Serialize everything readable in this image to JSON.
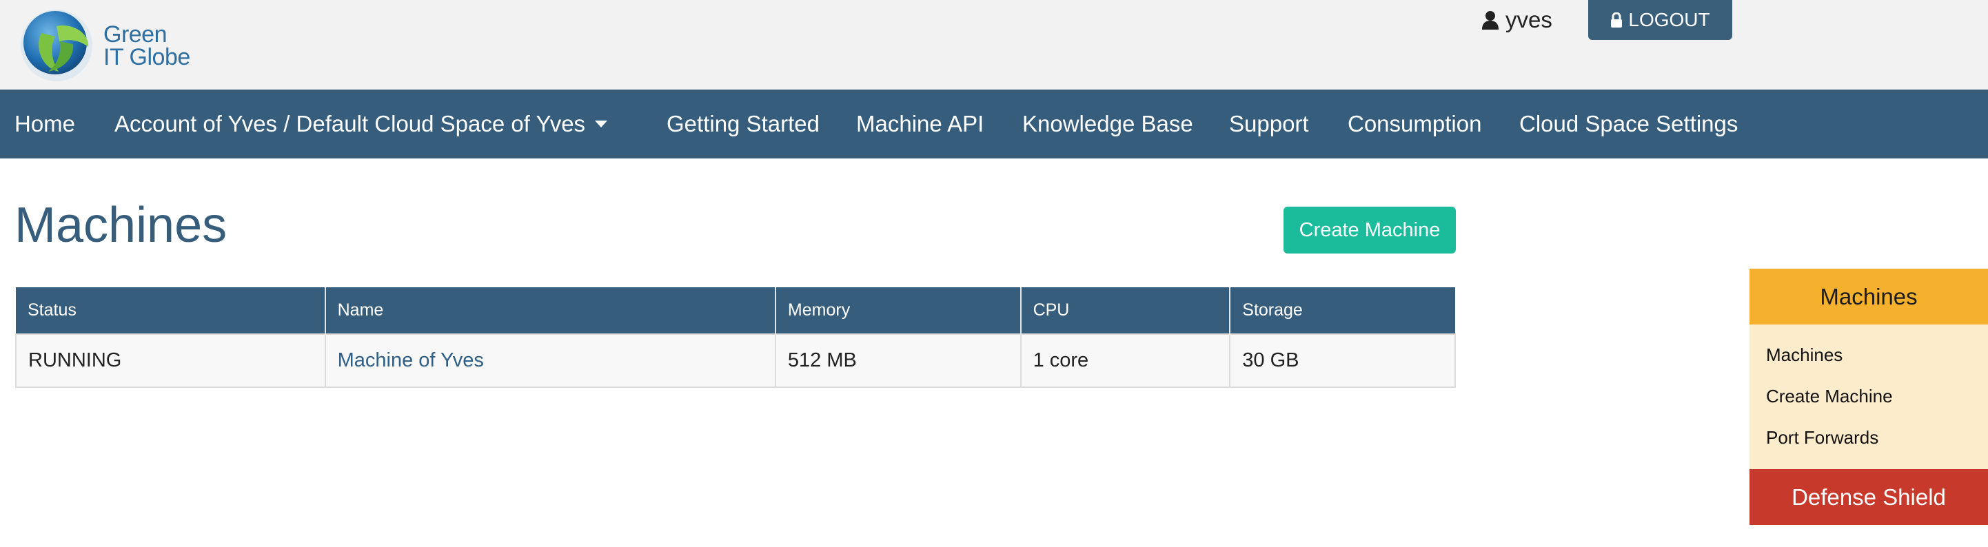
{
  "header": {
    "logo_line1": "Green",
    "logo_line2": "IT Globe",
    "user_icon": "user-icon",
    "username": "yves",
    "logout_icon": "lock-icon",
    "logout_label": "LOGOUT"
  },
  "nav": {
    "home": "Home",
    "account": "Account of Yves / Default Cloud Space of Yves",
    "getting_started": "Getting Started",
    "machine_api": "Machine API",
    "knowledge_base": "Knowledge Base",
    "support": "Support",
    "consumption": "Consumption",
    "cloud_space_settings": "Cloud Space Settings"
  },
  "main": {
    "title": "Machines",
    "create_button": "Create Machine",
    "table": {
      "columns": [
        "Status",
        "Name",
        "Memory",
        "CPU",
        "Storage"
      ],
      "rows": [
        [
          "RUNNING",
          "Machine of Yves",
          "512 MB",
          "1 core",
          "30 GB"
        ]
      ]
    }
  },
  "sidebar": {
    "header": "Machines",
    "items": [
      "Machines",
      "Create Machine",
      "Port Forwards"
    ],
    "footer": "Defense Shield"
  },
  "colors": {
    "navbar": "#365d7b",
    "accent_green": "#1abc9c",
    "sidebar_header": "#f5b12e",
    "sidebar_bg": "#fdeccc",
    "defense": "#c6392b"
  }
}
